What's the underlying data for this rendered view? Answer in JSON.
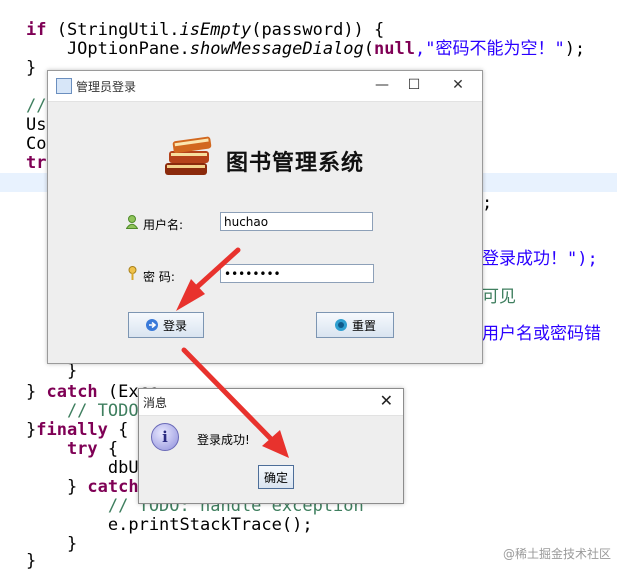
{
  "editor": {
    "lines": [
      {
        "kw": "if",
        "rest": " (StringUtil.",
        "italic": "isEmpty",
        "rest2": "(password)) {"
      },
      {
        "text": "    JOptionPane.",
        "italic": "showMessageDialog",
        "rest": "(",
        "kw": "null",
        "str": ",\"密码不能为空！\"",
        "end": ");"
      },
      {
        "text": "}"
      },
      {
        "text": "//"
      },
      {
        "text": "Use"
      },
      {
        "text": "Con"
      },
      {
        "kw": "tr"
      },
      {
        "text": ";"
      },
      {
        "str": "登录成功！\");"
      },
      {
        "cm": "可见"
      },
      {
        "cn": "用户名或密码错"
      },
      {
        "text": "    }"
      },
      {
        "text": "} ",
        "kw": "catch",
        "rest": " (Exce"
      },
      {
        "cm": "    // TODO"
      },
      {
        "text": "}",
        "kw": "finally",
        "rest": " {"
      },
      {
        "kw": "    try",
        "rest": " {"
      },
      {
        "text": "        dbU"
      },
      {
        "text": "    } ",
        "kw": "catch"
      },
      {
        "cm": "        // TODO: handle exception"
      },
      {
        "text": "        e.printStackTrace();"
      },
      {
        "text": "    }"
      },
      {
        "text": "}"
      }
    ]
  },
  "window": {
    "title": "管理员登录",
    "app_title": "图书管理系统",
    "username_label": "用户名:",
    "username_value": "huchao",
    "password_label": "密 码:",
    "password_value": "••••••••",
    "login_label": "登录",
    "reset_label": "重置",
    "minimize": "—",
    "maximize": "☐",
    "close": "✕"
  },
  "dialog": {
    "title": "消息",
    "message": "登录成功!",
    "ok_label": "确定",
    "close": "✕"
  },
  "watermark": "@稀土掘金技术社区",
  "colors": {
    "keyword": "#7f0055",
    "string": "#2a00ff",
    "comment": "#3f7f5f",
    "arrow": "#e8322d",
    "accent": "#4d6e99"
  }
}
